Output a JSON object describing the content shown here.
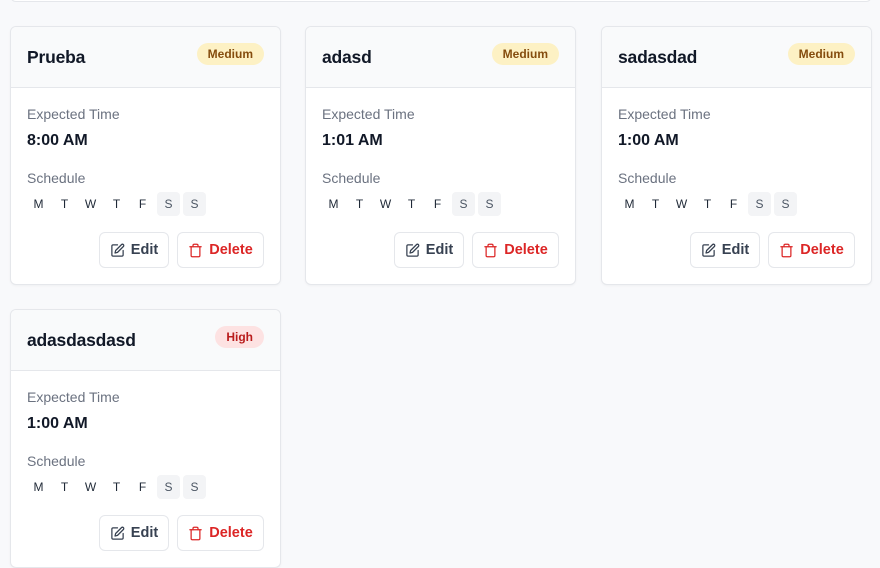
{
  "labels": {
    "expected_time": "Expected Time",
    "schedule": "Schedule",
    "edit": "Edit",
    "delete": "Delete"
  },
  "days": [
    "M",
    "T",
    "W",
    "T",
    "F",
    "S",
    "S"
  ],
  "colors": {
    "medium_badge_bg": "#fdf1c4",
    "medium_badge_text": "#854d0e",
    "high_badge_bg": "#fde2e2",
    "high_badge_text": "#b91c1c",
    "delete_text": "#dc2626"
  },
  "cards": [
    {
      "title": "Prueba",
      "priority": "Medium",
      "time": "8:00 AM",
      "active_days": [
        true,
        true,
        true,
        true,
        true,
        false,
        false
      ]
    },
    {
      "title": "adasd",
      "priority": "Medium",
      "time": "1:01 AM",
      "active_days": [
        true,
        true,
        true,
        true,
        true,
        false,
        false
      ]
    },
    {
      "title": "sadasdad",
      "priority": "Medium",
      "time": "1:00 AM",
      "active_days": [
        true,
        true,
        true,
        true,
        true,
        false,
        false
      ]
    },
    {
      "title": "adasdasdasd",
      "priority": "High",
      "time": "1:00 AM",
      "active_days": [
        true,
        true,
        true,
        true,
        true,
        false,
        false
      ]
    }
  ]
}
